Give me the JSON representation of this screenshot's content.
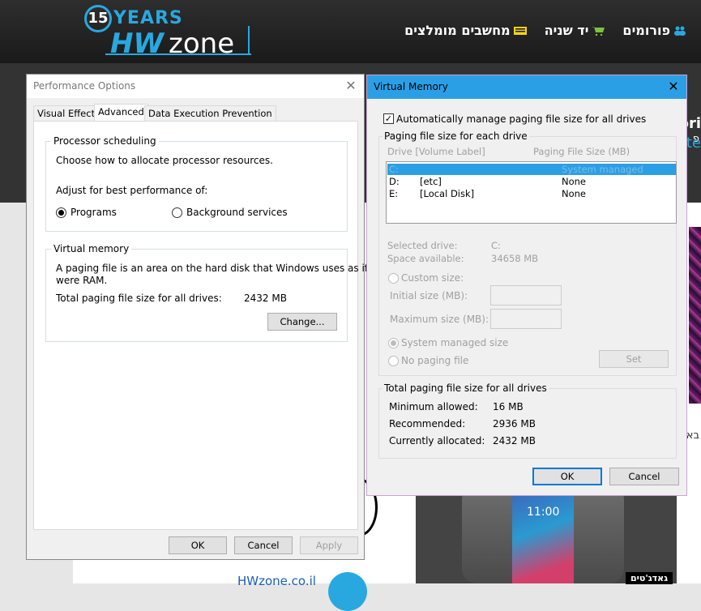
{
  "site": {
    "logo_number": "15",
    "logo_years": "YEARS",
    "logo_hw": "HW",
    "logo_zone": "zone",
    "nav": [
      {
        "label": "פורומים",
        "icon": "users-icon"
      },
      {
        "label": "יד שניה",
        "icon": "cart-icon"
      },
      {
        "label": "מחשבים מומלצים",
        "icon": "keyboard-icon"
      }
    ],
    "peek_heb": "פ",
    "peek_text": "ori",
    "peek_text2": "ste",
    "peek_ba": "בא",
    "phone_clock": "11:00",
    "gadgets_badge": "גאדג'טים",
    "link_text": "HWzone.co.il"
  },
  "perf": {
    "title": "Performance Options",
    "tabs": [
      "Visual Effects",
      "Advanced",
      "Data Execution Prevention"
    ],
    "active_tab": "Advanced",
    "processor": {
      "group_label": "Processor scheduling",
      "desc": "Choose how to allocate processor resources.",
      "adjust": "Adjust for best performance of:",
      "opt_programs": "Programs",
      "opt_background": "Background services",
      "selected": "Programs"
    },
    "vmem": {
      "group_label": "Virtual memory",
      "desc_line1": "A paging file is an area on the hard disk that Windows uses as if it",
      "desc_line2": "were RAM.",
      "total_label": "Total paging file size for all drives:",
      "total_value": "2432 MB",
      "change_button": "Change..."
    },
    "buttons": {
      "ok": "OK",
      "cancel": "Cancel",
      "apply": "Apply"
    }
  },
  "vm": {
    "title": "Virtual Memory",
    "auto_manage": "Automatically manage paging file size for all drives",
    "auto_checked": true,
    "each_drive_label": "Paging file size for each drive",
    "col_drive": "Drive  [Volume Label]",
    "col_size": "Paging File Size (MB)",
    "drives": [
      {
        "drive": "C:",
        "label": "",
        "size": "System managed",
        "selected": true
      },
      {
        "drive": "D:",
        "label": "[etc]",
        "size": "None",
        "selected": false
      },
      {
        "drive": "E:",
        "label": "[Local Disk]",
        "size": "None",
        "selected": false
      }
    ],
    "selected_drive_label": "Selected drive:",
    "selected_drive_value": "C:",
    "space_label": "Space available:",
    "space_value": "34658 MB",
    "custom_size": "Custom size:",
    "initial_label": "Initial size (MB):",
    "max_label": "Maximum size (MB):",
    "system_managed": "System managed size",
    "no_paging": "No paging file",
    "set_button": "Set",
    "totals_label": "Total paging file size for all drives",
    "min_label": "Minimum allowed:",
    "min_value": "16 MB",
    "rec_label": "Recommended:",
    "rec_value": "2936 MB",
    "cur_label": "Currently allocated:",
    "cur_value": "2432 MB",
    "buttons": {
      "ok": "OK",
      "cancel": "Cancel"
    }
  }
}
